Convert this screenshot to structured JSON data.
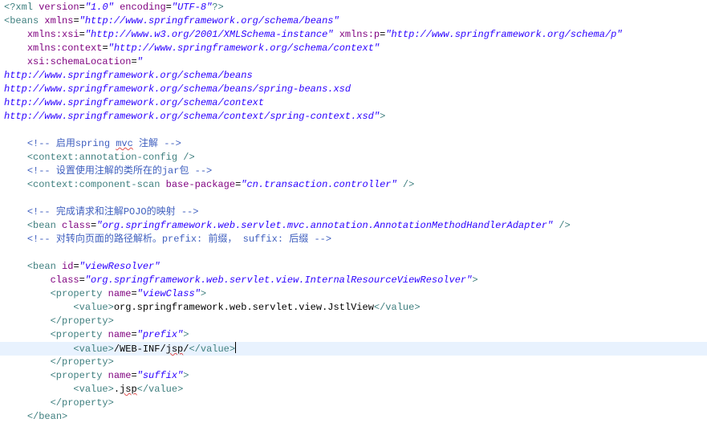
{
  "lines": [
    {
      "indent": "",
      "parts": [
        [
          "pi",
          "<?xml "
        ],
        [
          "attr",
          "version"
        ],
        [
          "text",
          "="
        ],
        [
          "val",
          "\"1.0\""
        ],
        [
          "text",
          " "
        ],
        [
          "attr",
          "encoding"
        ],
        [
          "text",
          "="
        ],
        [
          "val",
          "\"UTF-8\""
        ],
        [
          "pi",
          "?>"
        ]
      ]
    },
    {
      "indent": "",
      "parts": [
        [
          "tag",
          "<beans "
        ],
        [
          "attr",
          "xmlns"
        ],
        [
          "text",
          "="
        ],
        [
          "val",
          "\"http://www.springframework.org/schema/beans\""
        ]
      ]
    },
    {
      "indent": "    ",
      "parts": [
        [
          "attr",
          "xmlns:xsi"
        ],
        [
          "text",
          "="
        ],
        [
          "val",
          "\"http://www.w3.org/2001/XMLSchema-instance\""
        ],
        [
          "text",
          " "
        ],
        [
          "attr",
          "xmlns:p"
        ],
        [
          "text",
          "="
        ],
        [
          "val",
          "\"http://www.springframework.org/schema/p\""
        ]
      ]
    },
    {
      "indent": "    ",
      "parts": [
        [
          "attr",
          "xmlns:context"
        ],
        [
          "text",
          "="
        ],
        [
          "val",
          "\"http://www.springframework.org/schema/context\""
        ]
      ]
    },
    {
      "indent": "    ",
      "parts": [
        [
          "attr",
          "xsi:schemaLocation"
        ],
        [
          "text",
          "="
        ],
        [
          "val",
          "\""
        ]
      ]
    },
    {
      "indent": "",
      "parts": [
        [
          "val",
          "http://www.springframework.org/schema/beans"
        ]
      ]
    },
    {
      "indent": "",
      "parts": [
        [
          "val",
          "http://www.springframework.org/schema/beans/spring-beans.xsd"
        ]
      ]
    },
    {
      "indent": "",
      "parts": [
        [
          "val",
          "http://www.springframework.org/schema/context"
        ]
      ]
    },
    {
      "indent": "",
      "parts": [
        [
          "val",
          "http://www.springframework.org/schema/context/spring-context.xsd\""
        ],
        [
          "tag",
          ">"
        ]
      ]
    },
    {
      "indent": "",
      "parts": []
    },
    {
      "indent": "    ",
      "parts": [
        [
          "comment",
          "<!-- 启用spring "
        ],
        [
          "comment_sq",
          "mvc"
        ],
        [
          "comment",
          " 注解 -->"
        ]
      ]
    },
    {
      "indent": "    ",
      "parts": [
        [
          "tag",
          "<context:annotation-config />"
        ]
      ]
    },
    {
      "indent": "    ",
      "parts": [
        [
          "comment",
          "<!-- 设置使用注解的类所在的jar包 -->"
        ]
      ]
    },
    {
      "indent": "    ",
      "parts": [
        [
          "tag",
          "<context:component-scan "
        ],
        [
          "attr",
          "base-package"
        ],
        [
          "text",
          "="
        ],
        [
          "val",
          "\"cn.transaction.controller\""
        ],
        [
          "tag",
          " />"
        ]
      ]
    },
    {
      "indent": "",
      "parts": []
    },
    {
      "indent": "    ",
      "parts": [
        [
          "comment",
          "<!-- 完成请求和注解POJO的映射 -->"
        ]
      ]
    },
    {
      "indent": "    ",
      "parts": [
        [
          "tag",
          "<bean "
        ],
        [
          "attr",
          "class"
        ],
        [
          "text",
          "="
        ],
        [
          "val",
          "\"org.springframework.web.servlet.mvc.annotation.AnnotationMethodHandlerAdapter\""
        ],
        [
          "tag",
          " />"
        ]
      ]
    },
    {
      "indent": "    ",
      "parts": [
        [
          "comment",
          "<!-- 对转向页面的路径解析。prefix: 前缀， suffix: 后缀 -->"
        ]
      ]
    },
    {
      "indent": "",
      "parts": []
    },
    {
      "indent": "    ",
      "parts": [
        [
          "tag",
          "<bean "
        ],
        [
          "attr",
          "id"
        ],
        [
          "text",
          "="
        ],
        [
          "val",
          "\"viewResolver\""
        ]
      ]
    },
    {
      "indent": "        ",
      "parts": [
        [
          "attr",
          "class"
        ],
        [
          "text",
          "="
        ],
        [
          "val",
          "\"org.springframework.web.servlet.view.InternalResourceViewResolver\""
        ],
        [
          "tag",
          ">"
        ]
      ]
    },
    {
      "indent": "        ",
      "parts": [
        [
          "tag",
          "<property "
        ],
        [
          "attr",
          "name"
        ],
        [
          "text",
          "="
        ],
        [
          "val",
          "\"viewClass\""
        ],
        [
          "tag",
          ">"
        ]
      ]
    },
    {
      "indent": "            ",
      "parts": [
        [
          "tag",
          "<value>"
        ],
        [
          "text",
          "org.springframework.web.servlet.view.JstlView"
        ],
        [
          "tag",
          "</value>"
        ]
      ]
    },
    {
      "indent": "        ",
      "parts": [
        [
          "tag",
          "</property>"
        ]
      ]
    },
    {
      "indent": "        ",
      "parts": [
        [
          "tag",
          "<property "
        ],
        [
          "attr",
          "name"
        ],
        [
          "text",
          "="
        ],
        [
          "val",
          "\"prefix\""
        ],
        [
          "tag",
          ">"
        ]
      ]
    },
    {
      "indent": "            ",
      "current": true,
      "parts": [
        [
          "tag",
          "<value>"
        ],
        [
          "text",
          "/WEB-INF/"
        ],
        [
          "text_sq",
          "jsp"
        ],
        [
          "text",
          "/"
        ],
        [
          "tag",
          "</value>"
        ]
      ]
    },
    {
      "indent": "        ",
      "parts": [
        [
          "tag",
          "</property>"
        ]
      ]
    },
    {
      "indent": "        ",
      "parts": [
        [
          "tag",
          "<property "
        ],
        [
          "attr",
          "name"
        ],
        [
          "text",
          "="
        ],
        [
          "val",
          "\"suffix\""
        ],
        [
          "tag",
          ">"
        ]
      ]
    },
    {
      "indent": "            ",
      "parts": [
        [
          "tag",
          "<value>"
        ],
        [
          "text",
          "."
        ],
        [
          "text_sq",
          "jsp"
        ],
        [
          "tag",
          "</value>"
        ]
      ]
    },
    {
      "indent": "        ",
      "parts": [
        [
          "tag",
          "</property>"
        ]
      ]
    },
    {
      "indent": "    ",
      "parts": [
        [
          "tag",
          "</bean>"
        ]
      ]
    }
  ],
  "colors": {
    "tag": "#3f7f7f",
    "attr": "#7f007f",
    "val": "#2a00ff",
    "comment": "#3f5fbf",
    "text": "#000000",
    "current_line": "#e8f2fe"
  }
}
